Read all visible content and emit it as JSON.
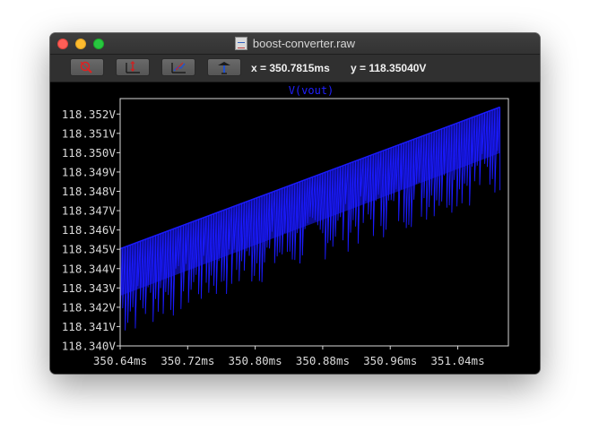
{
  "window": {
    "title": "boost-converter.raw"
  },
  "toolbar": {
    "buttons": [
      {
        "icon": "zoom-out-icon"
      },
      {
        "icon": "autoscale-y-icon"
      },
      {
        "icon": "zoom-fit-icon"
      },
      {
        "icon": "pick-point-icon"
      }
    ],
    "cursor_x": "x = 350.7815ms",
    "cursor_y": "y = 118.35040V"
  },
  "colors": {
    "trace": "#1a1aff",
    "background": "#000000",
    "axes": "#d9d9d9"
  },
  "chart_data": {
    "type": "line",
    "title": "V(vout)",
    "series": [
      {
        "name": "V(vout)",
        "description_of_shape": "upward ripple band",
        "upper_envelope": [
          [
            350.64,
            118.34503
          ],
          [
            351.09,
            118.35236
          ]
        ],
        "lower_envelope": [
          [
            350.64,
            118.34015
          ],
          [
            351.09,
            118.3476
          ]
        ]
      }
    ],
    "x_ticks": [
      "350.64ms",
      "350.72ms",
      "350.80ms",
      "350.88ms",
      "350.96ms",
      "351.04ms"
    ],
    "y_ticks": [
      "118.352V",
      "118.351V",
      "118.350V",
      "118.349V",
      "118.348V",
      "118.347V",
      "118.346V",
      "118.345V",
      "118.344V",
      "118.343V",
      "118.342V",
      "118.341V",
      "118.340V"
    ],
    "xlim": [
      350.64,
      351.1
    ],
    "ylim": [
      118.34,
      118.3528
    ],
    "x_unit": "ms",
    "y_unit": "V",
    "grid": false
  }
}
